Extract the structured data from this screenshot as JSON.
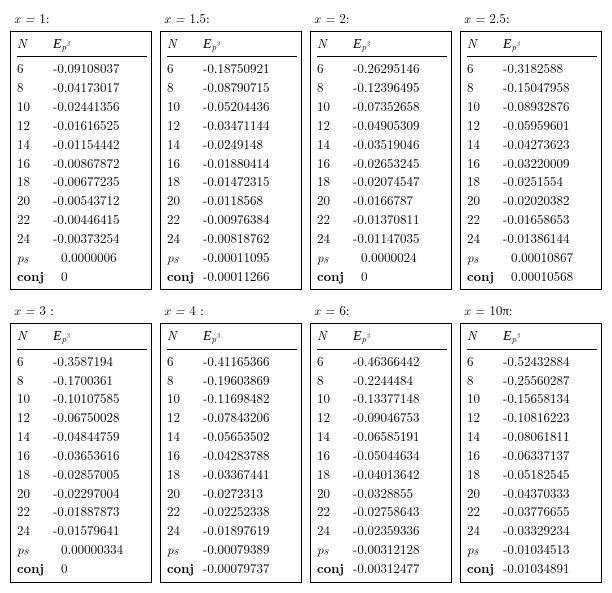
{
  "panels": [
    {
      "title_prefix": "x = ",
      "x": "1",
      "title_suffix": ":",
      "header_N": "N",
      "header_E_base": "E",
      "header_E_sub": "p3",
      "rows": [
        {
          "N": "6",
          "E": "-0.09108037"
        },
        {
          "N": "8",
          "E": "-0.04173017"
        },
        {
          "N": "10",
          "E": "-0.02441356"
        },
        {
          "N": "12",
          "E": "-0.01616525"
        },
        {
          "N": "14",
          "E": "-0.01154442"
        },
        {
          "N": "16",
          "E": "-0.00867872"
        },
        {
          "N": "18",
          "E": "-0.00677235"
        },
        {
          "N": "20",
          "E": "-0.00543712"
        },
        {
          "N": "22",
          "E": "-0.00446415"
        },
        {
          "N": "24",
          "E": "-0.00373254"
        }
      ],
      "p8_label_base": "p",
      "p8_label_sub": "8",
      "p8_value": "0.0000006",
      "p8_indent": true,
      "conj_label": "conj",
      "conj_value": "0",
      "conj_indent": true
    },
    {
      "title_prefix": "x = ",
      "x": "1.5",
      "title_suffix": ":",
      "header_N": "N",
      "header_E_base": "E",
      "header_E_sub": "p3",
      "rows": [
        {
          "N": "6",
          "E": "-0.18750921"
        },
        {
          "N": "8",
          "E": "-0.08790715"
        },
        {
          "N": "10",
          "E": "-0.05204436"
        },
        {
          "N": "12",
          "E": "-0.03471144"
        },
        {
          "N": "14",
          "E": "-0.0249148"
        },
        {
          "N": "16",
          "E": "-0.01880414"
        },
        {
          "N": "18",
          "E": "-0.01472315"
        },
        {
          "N": "20",
          "E": "-0.0118568"
        },
        {
          "N": "22",
          "E": "-0.00976384"
        },
        {
          "N": "24",
          "E": "-0.00818762"
        }
      ],
      "p8_label_base": "p",
      "p8_label_sub": "8",
      "p8_value": "-0.00011095",
      "p8_indent": false,
      "conj_label": "conj",
      "conj_value": "-0.00011266",
      "conj_indent": false
    },
    {
      "title_prefix": "x = ",
      "x": "2",
      "title_suffix": ":",
      "header_N": "N",
      "header_E_base": "E",
      "header_E_sub": "p3",
      "rows": [
        {
          "N": "6",
          "E": "-0.26295146"
        },
        {
          "N": "8",
          "E": "-0.12396495"
        },
        {
          "N": "10",
          "E": "-0.07352658"
        },
        {
          "N": "12",
          "E": "-0.04905309"
        },
        {
          "N": "14",
          "E": "-0.03519046"
        },
        {
          "N": "16",
          "E": "-0.02653245"
        },
        {
          "N": "18",
          "E": "-0.02074547"
        },
        {
          "N": "20",
          "E": "-0.0166787"
        },
        {
          "N": "22",
          "E": "-0.01370811"
        },
        {
          "N": "24",
          "E": "-0.01147035"
        }
      ],
      "p8_label_base": "p",
      "p8_label_sub": "8",
      "p8_value": "0.0000024",
      "p8_indent": true,
      "conj_label": "conj",
      "conj_value": "0",
      "conj_indent": true
    },
    {
      "title_prefix": "x = ",
      "x": "2.5",
      "title_suffix": ":",
      "header_N": "N",
      "header_E_base": "E",
      "header_E_sub": "p3",
      "rows": [
        {
          "N": "6",
          "E": "-0.3182588"
        },
        {
          "N": "8",
          "E": "-0.15047958"
        },
        {
          "N": "10",
          "E": "-0.08932876"
        },
        {
          "N": "12",
          "E": "-0.05959601"
        },
        {
          "N": "14",
          "E": "-0.04273623"
        },
        {
          "N": "16",
          "E": "-0.03220009"
        },
        {
          "N": "18",
          "E": "-0.0251554"
        },
        {
          "N": "20",
          "E": "-0.02020382"
        },
        {
          "N": "22",
          "E": "-0.01658653"
        },
        {
          "N": "24",
          "E": "-0.01386144"
        }
      ],
      "p8_label_base": "p",
      "p8_label_sub": "8",
      "p8_value": "0.00010867",
      "p8_indent": true,
      "conj_label": "conj",
      "conj_value": "0.00010568",
      "conj_indent": true
    },
    {
      "title_prefix": "x = ",
      "x": "3 ",
      "title_suffix": ":",
      "header_N": "N",
      "header_E_base": "E",
      "header_E_sub": "p3",
      "rows": [
        {
          "N": "6",
          "E": "-0.3587194"
        },
        {
          "N": "8",
          "E": "-0.1700361"
        },
        {
          "N": "10",
          "E": "-0.10107585"
        },
        {
          "N": "12",
          "E": "-0.06750028"
        },
        {
          "N": "14",
          "E": "-0.04844759"
        },
        {
          "N": "16",
          "E": "-0.03653616"
        },
        {
          "N": "18",
          "E": "-0.02857005"
        },
        {
          "N": "20",
          "E": "-0.02297004"
        },
        {
          "N": "22",
          "E": "-0.01887873"
        },
        {
          "N": "24",
          "E": "-0.01579641"
        }
      ],
      "p8_label_base": "p",
      "p8_label_sub": "8",
      "p8_value": "0.00000334",
      "p8_indent": true,
      "conj_label": "conj",
      "conj_value": "0",
      "conj_indent": true
    },
    {
      "title_prefix": "x = ",
      "x": "4 ",
      "title_suffix": ":",
      "header_N": "N",
      "header_E_base": "E",
      "header_E_sub": "p3",
      "rows": [
        {
          "N": "6",
          "E": "-0.41165366"
        },
        {
          "N": "8",
          "E": "-0.19603869"
        },
        {
          "N": "10",
          "E": "-0.11698482"
        },
        {
          "N": "12",
          "E": "-0.07843206"
        },
        {
          "N": "14",
          "E": "-0.05653502"
        },
        {
          "N": "16",
          "E": "-0.04283788"
        },
        {
          "N": "18",
          "E": "-0.03367441"
        },
        {
          "N": "20",
          "E": "-0.0272313"
        },
        {
          "N": "22",
          "E": "-0.02252338"
        },
        {
          "N": "24",
          "E": "-0.01897619"
        }
      ],
      "p8_label_base": "p",
      "p8_label_sub": "8",
      "p8_value": "-0.00079389",
      "p8_indent": false,
      "conj_label": "conj",
      "conj_value": "-0.00079737",
      "conj_indent": false
    },
    {
      "title_prefix": "x = ",
      "x": "6",
      "title_suffix": ":",
      "header_N": "N",
      "header_E_base": "E",
      "header_E_sub": "p3",
      "rows": [
        {
          "N": "6",
          "E": "-0.46366442"
        },
        {
          "N": "8",
          "E": "-0.2244484"
        },
        {
          "N": "10",
          "E": "-0.13377148"
        },
        {
          "N": "12",
          "E": "-0.09046753"
        },
        {
          "N": "14",
          "E": "-0.06585191"
        },
        {
          "N": "16",
          "E": "-0.05044634"
        },
        {
          "N": "18",
          "E": "-0.04013642"
        },
        {
          "N": "20",
          "E": "-0.0328855"
        },
        {
          "N": "22",
          "E": "-0.02758643"
        },
        {
          "N": "24",
          "E": "-0.02359336"
        }
      ],
      "p8_label_base": "p",
      "p8_label_sub": "8",
      "p8_value": "-0.00312128",
      "p8_indent": false,
      "conj_label": "conj",
      "conj_value": "-0.00312477",
      "conj_indent": false
    },
    {
      "title_prefix": "x = ",
      "x": "10π",
      "title_suffix": ":",
      "header_N": "N",
      "header_E_base": "E",
      "header_E_sub": "p3",
      "rows": [
        {
          "N": "6",
          "E": "-0.52432884"
        },
        {
          "N": "8",
          "E": "-0.25560287"
        },
        {
          "N": "10",
          "E": "-0.15658134"
        },
        {
          "N": "12",
          "E": "-0.10816223"
        },
        {
          "N": "14",
          "E": "-0.08061811"
        },
        {
          "N": "16",
          "E": "-0.06337137"
        },
        {
          "N": "18",
          "E": "-0.05182545"
        },
        {
          "N": "20",
          "E": "-0.04370333"
        },
        {
          "N": "22",
          "E": "-0.03776655"
        },
        {
          "N": "24",
          "E": "-0.03329234"
        }
      ],
      "p8_label_base": "p",
      "p8_label_sub": "8",
      "p8_value": "-0.01034513",
      "p8_indent": false,
      "conj_label": "conj",
      "conj_value": "-0.01034891",
      "conj_indent": false
    }
  ]
}
